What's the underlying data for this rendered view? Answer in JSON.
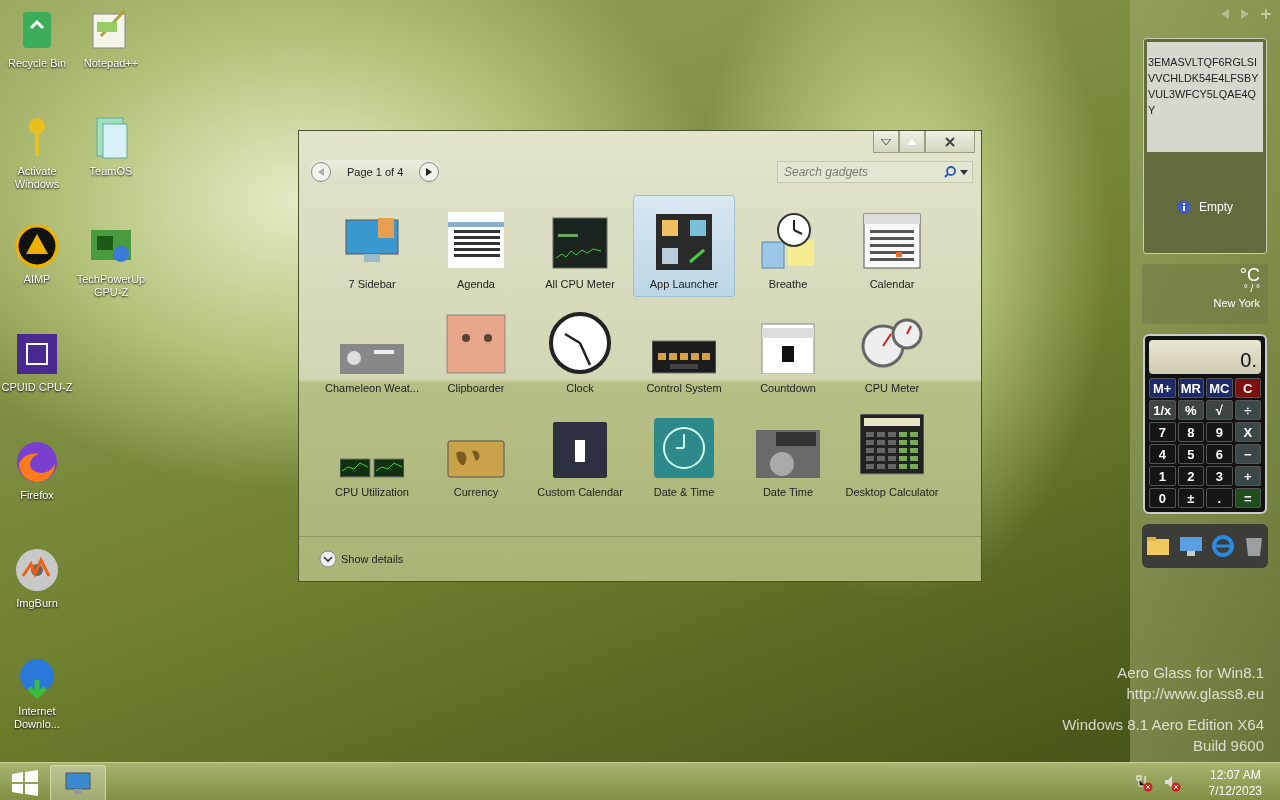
{
  "desktop_icons": [
    {
      "label": "Recycle Bin"
    },
    {
      "label": "Activate Windows"
    },
    {
      "label": "AIMP"
    },
    {
      "label": "CPUID CPU-Z"
    },
    {
      "label": "Firefox"
    },
    {
      "label": "ImgBurn"
    },
    {
      "label": "Internet Downlo..."
    },
    {
      "label": "Notepad++"
    },
    {
      "label": "TeamOS"
    },
    {
      "label": "TechPowerUp GPU-Z"
    }
  ],
  "gadget_window": {
    "pager": "Page 1 of 4",
    "search": {
      "placeholder": "Search gadgets"
    },
    "gadgets": [
      {
        "name": "7 Sidebar",
        "selected": false
      },
      {
        "name": "Agenda",
        "selected": false
      },
      {
        "name": "All CPU Meter",
        "selected": false
      },
      {
        "name": "App Launcher",
        "selected": true
      },
      {
        "name": "Breathe",
        "selected": false
      },
      {
        "name": "Calendar",
        "selected": false
      },
      {
        "name": "Chameleon Weat...",
        "selected": false
      },
      {
        "name": "Clipboarder",
        "selected": false
      },
      {
        "name": "Clock",
        "selected": false
      },
      {
        "name": "Control System",
        "selected": false
      },
      {
        "name": "Countdown",
        "selected": false
      },
      {
        "name": "CPU Meter",
        "selected": false
      },
      {
        "name": "CPU Utilization",
        "selected": false
      },
      {
        "name": "Currency",
        "selected": false
      },
      {
        "name": "Custom Calendar",
        "selected": false
      },
      {
        "name": "Date & Time",
        "selected": false
      },
      {
        "name": "Date Time",
        "selected": false
      },
      {
        "name": "Desktop Calculator",
        "selected": false
      }
    ],
    "details_toggle": "Show details"
  },
  "sidebar": {
    "note": {
      "text": "3EMASVLTQF6RGLSIVVCHLDK54E4LFSBYVUL3WFCY5LQAE4QY",
      "status": "Empty"
    },
    "weather": {
      "unit": "°C",
      "range": "° / °",
      "city": "New York"
    },
    "calculator": {
      "display": "0.",
      "keys": [
        {
          "label": "M+",
          "kind": "memory"
        },
        {
          "label": "MR",
          "kind": "memory"
        },
        {
          "label": "MC",
          "kind": "memory"
        },
        {
          "label": "C",
          "kind": "clear"
        },
        {
          "label": "1/x",
          "kind": "func"
        },
        {
          "label": "%",
          "kind": "func"
        },
        {
          "label": "√",
          "kind": "func"
        },
        {
          "label": "÷",
          "kind": "op"
        },
        {
          "label": "7",
          "kind": "digit"
        },
        {
          "label": "8",
          "kind": "digit"
        },
        {
          "label": "9",
          "kind": "digit"
        },
        {
          "label": "X",
          "kind": "op"
        },
        {
          "label": "4",
          "kind": "digit"
        },
        {
          "label": "5",
          "kind": "digit"
        },
        {
          "label": "6",
          "kind": "digit"
        },
        {
          "label": "−",
          "kind": "op"
        },
        {
          "label": "1",
          "kind": "digit"
        },
        {
          "label": "2",
          "kind": "digit"
        },
        {
          "label": "3",
          "kind": "digit"
        },
        {
          "label": "+",
          "kind": "op"
        },
        {
          "label": "0",
          "kind": "digit"
        },
        {
          "label": "±",
          "kind": "digit"
        },
        {
          "label": ".",
          "kind": "digit"
        },
        {
          "label": "=",
          "kind": "equals"
        }
      ]
    }
  },
  "system_text": [
    "Aero Glass for Win8.1",
    "http://www.glass8.eu",
    "Windows 8.1 Aero Edition X64",
    "Build 9600"
  ],
  "taskbar": {
    "time": "12:07 AM",
    "date": "7/12/2023"
  }
}
